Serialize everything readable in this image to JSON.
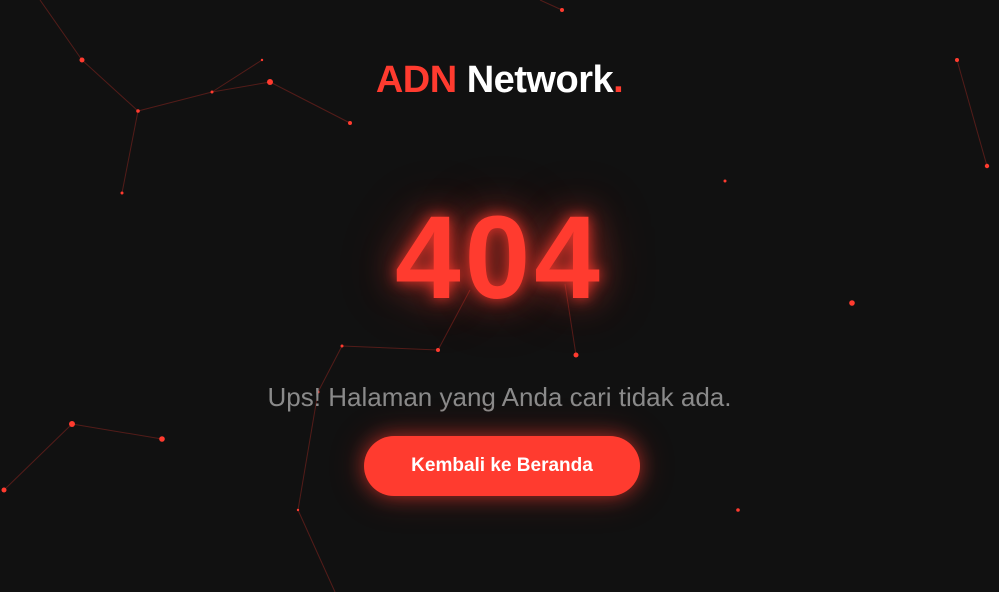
{
  "logo": {
    "brand": "ADN",
    "name": " Network",
    "dot": "."
  },
  "error": {
    "code": "404",
    "message": "Ups! Halaman yang Anda cari tidak ada."
  },
  "actions": {
    "home_label": "Kembali ke Beranda"
  },
  "colors": {
    "background": "#111111",
    "accent": "#ff3b2f",
    "text_primary": "#ffffff",
    "text_muted": "#8a8a8a"
  }
}
